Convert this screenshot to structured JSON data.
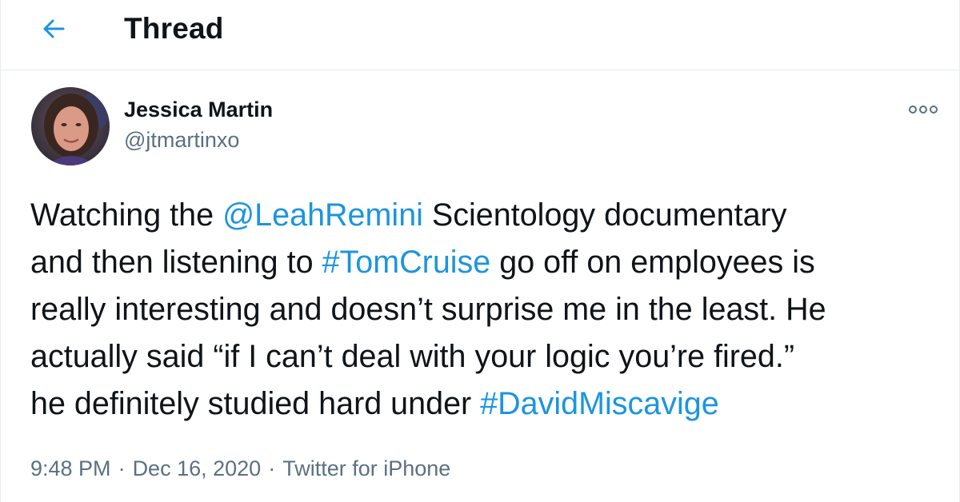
{
  "header": {
    "back_icon": "arrow-left-icon",
    "title": "Thread"
  },
  "tweet": {
    "author": {
      "name": "Jessica Martin",
      "handle": "@jtmartinxo",
      "avatar": "avatar-photo"
    },
    "more_icon": "more-horizontal-icon",
    "text": {
      "t1": "Watching the ",
      "mention": "@LeahRemini",
      "t2": " Scientology documentary\nand then listening to ",
      "hashtag1": "#TomCruise",
      "t3": " go off on employees is\nreally interesting and doesn’t surprise me in the least. He\nactually said “if I can’t deal with your logic you’re fired.”\nhe definitely studied hard under ",
      "hashtag2": "#DavidMiscavige"
    },
    "meta": {
      "time": "9:48 PM",
      "separator": "·",
      "date": "Dec 16, 2020",
      "source": "Twitter for iPhone"
    }
  },
  "colors": {
    "link": "#1b95e0",
    "secondary_text": "#5b7083",
    "divider": "#e6ecf0"
  }
}
